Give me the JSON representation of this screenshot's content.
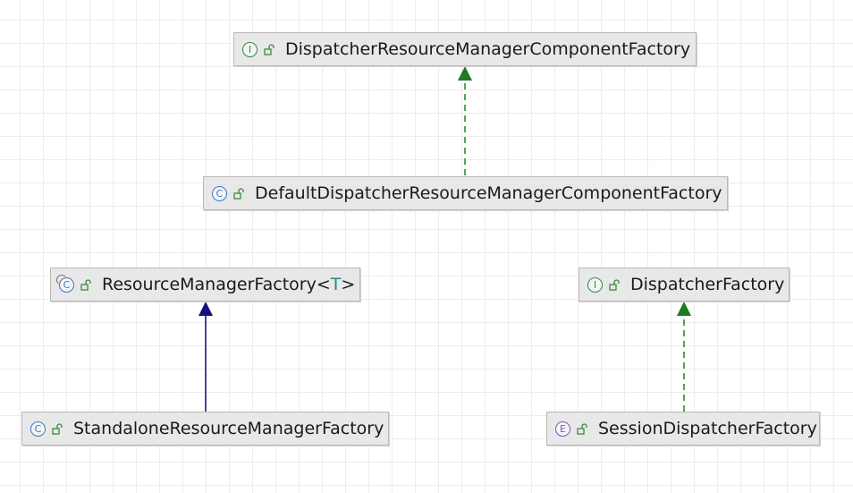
{
  "nodes": [
    {
      "id": "dispatcher-rm-component-factory",
      "kind": "interface",
      "kind_glyph": "I",
      "name": "DispatcherResourceManagerComponentFactory"
    },
    {
      "id": "default-dispatcher-rm-component-factory",
      "kind": "class",
      "kind_glyph": "C",
      "name": "DefaultDispatcherResourceManagerComponentFactory"
    },
    {
      "id": "resource-manager-factory",
      "kind": "abstract-class",
      "kind_glyph": "C",
      "name": "ResourceManagerFactory<",
      "type_param": "T",
      "name_suffix": ">"
    },
    {
      "id": "dispatcher-factory",
      "kind": "interface",
      "kind_glyph": "I",
      "name": "DispatcherFactory"
    },
    {
      "id": "standalone-rm-factory",
      "kind": "class",
      "kind_glyph": "C",
      "name": "StandaloneResourceManagerFactory"
    },
    {
      "id": "session-dispatcher-factory",
      "kind": "enum",
      "kind_glyph": "E",
      "name": "SessionDispatcherFactory"
    }
  ],
  "edges": [
    {
      "from": "default-dispatcher-rm-component-factory",
      "to": "dispatcher-rm-component-factory",
      "relation": "implements",
      "style": "dashed",
      "color": "#2e8b2e"
    },
    {
      "from": "standalone-rm-factory",
      "to": "resource-manager-factory",
      "relation": "extends",
      "style": "solid",
      "color": "#1c1c80"
    },
    {
      "from": "session-dispatcher-factory",
      "to": "dispatcher-factory",
      "relation": "implements",
      "style": "dashed",
      "color": "#2e8b2e"
    }
  ],
  "icons": {
    "visibility": "unlock-icon"
  }
}
